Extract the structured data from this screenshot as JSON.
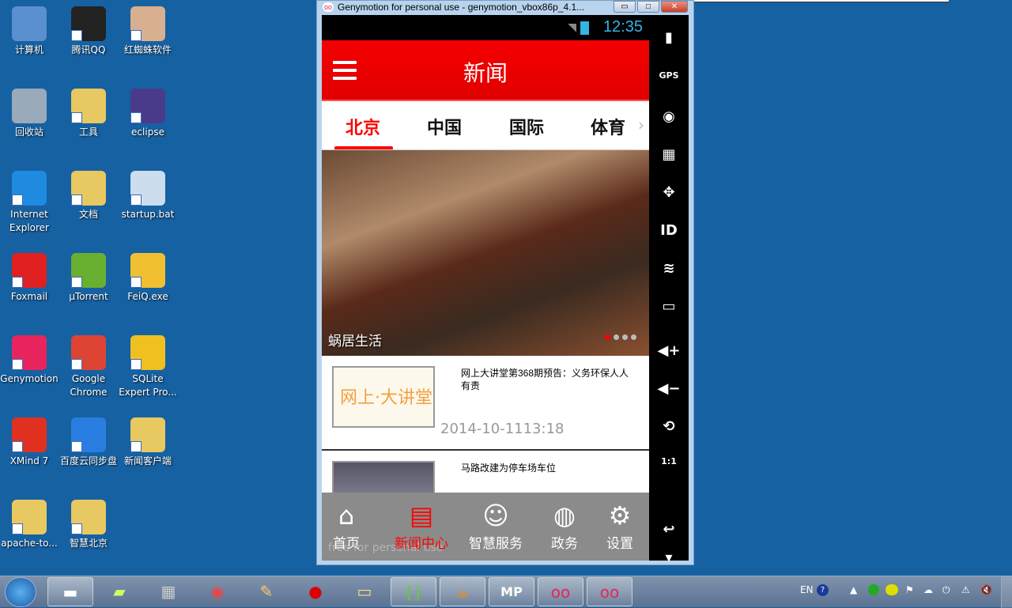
{
  "desktop_icons": [
    {
      "label": "计算机",
      "color": "#5a8fd0"
    },
    {
      "label": "回收站",
      "color": "#9ab"
    },
    {
      "label": "Internet Explorer",
      "color": "#1e8ae0"
    },
    {
      "label": "Foxmail",
      "color": "#e02020"
    },
    {
      "label": "Genymotion",
      "color": "#e8245e"
    },
    {
      "label": "XMind 7",
      "color": "#e03020"
    },
    {
      "label": "apache-to...",
      "color": "#e8c860"
    },
    {
      "label": "腾讯QQ",
      "color": "#222"
    },
    {
      "label": "工具",
      "color": "#e8c860"
    },
    {
      "label": "文档",
      "color": "#e8c860"
    },
    {
      "label": "µTorrent",
      "color": "#6ab030"
    },
    {
      "label": "Google Chrome",
      "color": "#dd4433"
    },
    {
      "label": "百度云同步盘",
      "color": "#2a7de0"
    },
    {
      "label": "智慧北京",
      "color": "#e8c860"
    },
    {
      "label": "红蜘蛛软件",
      "color": "#d8b090"
    },
    {
      "label": "eclipse",
      "color": "#4a3a8a"
    },
    {
      "label": "startup.bat",
      "color": "#cde"
    },
    {
      "label": "FeiQ.exe",
      "color": "#f0c030"
    },
    {
      "label": "SQLite Expert Pro...",
      "color": "#f0c020"
    },
    {
      "label": "新闻客户端",
      "color": "#e8c860"
    }
  ],
  "window": {
    "title": "Genymotion for personal use - genymotion_vbox86p_4.1...",
    "logo": "oo",
    "minimize": "▭",
    "maximize": "□",
    "close": "✕"
  },
  "status_bar": {
    "time": "12:35"
  },
  "app": {
    "header_title": "新闻",
    "tabs": [
      {
        "label": "北京",
        "active": true
      },
      {
        "label": "中国"
      },
      {
        "label": "国际"
      },
      {
        "label": "体育"
      }
    ],
    "banner": {
      "caption": "蜗居生活",
      "dots": 4,
      "active_dot": 0
    },
    "news": [
      {
        "title": "网上大讲堂第368期预告：义务环保人人有责",
        "date": "2014-10-1113:18",
        "thumb_text": "网上·大讲堂"
      },
      {
        "title": "马路改建为停车场车位"
      }
    ],
    "bottom_nav": [
      {
        "label": "首页",
        "icon": "home-icon",
        "glyph": "⌂"
      },
      {
        "label": "新闻中心",
        "icon": "newspaper-icon",
        "glyph": "▤",
        "active": true
      },
      {
        "label": "智慧服务",
        "icon": "smiley-icon",
        "glyph": "☺"
      },
      {
        "label": "政务",
        "icon": "globe-icon",
        "glyph": "◍"
      },
      {
        "label": "设置",
        "icon": "gear-icon",
        "glyph": "⚙"
      }
    ],
    "watermark": "free for personal use",
    "accent": "#f00000"
  },
  "emulator_sidebar": [
    {
      "icon": "battery-icon",
      "glyph": "▮"
    },
    {
      "icon": "gps-icon",
      "glyph": "GPS"
    },
    {
      "icon": "webcam-icon",
      "glyph": "◉"
    },
    {
      "icon": "clapper-icon",
      "glyph": "▦"
    },
    {
      "icon": "move-icon",
      "glyph": "✥"
    },
    {
      "icon": "id-icon",
      "glyph": "ID"
    },
    {
      "icon": "rss-icon",
      "glyph": "≋"
    },
    {
      "icon": "sms-icon",
      "glyph": "▭"
    },
    {
      "icon": "volume-up-icon",
      "glyph": "◀+"
    },
    {
      "icon": "volume-down-icon",
      "glyph": "◀−"
    },
    {
      "icon": "rotate-icon",
      "glyph": "⟲"
    },
    {
      "icon": "scale-icon",
      "glyph": "1:1"
    },
    {
      "icon": "back-icon",
      "glyph": "↩"
    },
    {
      "icon": "more-icon",
      "glyph": "▾"
    }
  ],
  "taskbar": {
    "items": [
      {
        "icon": "cmd-icon",
        "glyph": "▬",
        "open": true
      },
      {
        "icon": "sticky-notes-icon",
        "glyph": "▰"
      },
      {
        "icon": "calculator-icon",
        "glyph": "▦"
      },
      {
        "icon": "chrome-icon",
        "glyph": "◉"
      },
      {
        "icon": "paint-icon",
        "glyph": "✎"
      },
      {
        "icon": "opera-icon",
        "glyph": "●"
      },
      {
        "icon": "explorer-icon",
        "glyph": "▭"
      },
      {
        "icon": "brackets-icon",
        "glyph": "{}",
        "open": true
      },
      {
        "icon": "java-icon",
        "glyph": "☕",
        "open": true
      },
      {
        "icon": "mp-icon",
        "glyph": "MP",
        "open": true
      },
      {
        "icon": "genymotion-icon",
        "glyph": "oo",
        "open": true
      },
      {
        "icon": "genymotion-icon",
        "glyph": "oo",
        "open": true
      }
    ],
    "tray": {
      "lang": "EN"
    }
  }
}
